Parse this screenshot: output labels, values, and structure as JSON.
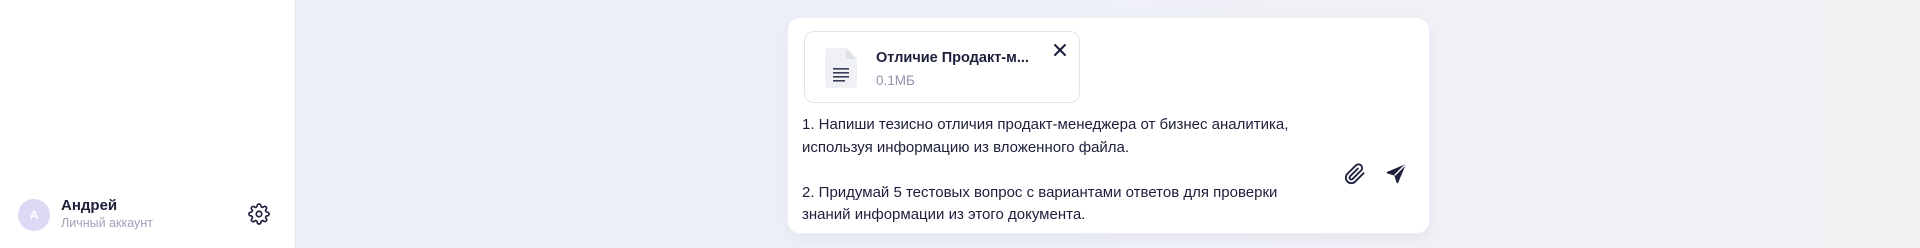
{
  "sidebar": {
    "user": {
      "avatar_initial": "А",
      "name": "Андрей",
      "subtitle": "Личный аккаунт"
    },
    "settings_icon": "gear-icon"
  },
  "composer": {
    "attachment": {
      "name": "Отличие Продакт-м...",
      "size": "0.1МБ",
      "icon": "document-icon"
    },
    "message_lines": [
      "1. Напиши тезисно отличия продакт-менеджера от бизнес аналитика,",
      "используя информацию из вложенного файла.",
      "",
      "2. Придумай 5 тестовых вопрос с вариантами ответов для проверки",
      "знаний информации из этого документа."
    ],
    "icons": {
      "attach": "paperclip-icon",
      "send": "send-icon",
      "remove": "close-icon"
    }
  }
}
